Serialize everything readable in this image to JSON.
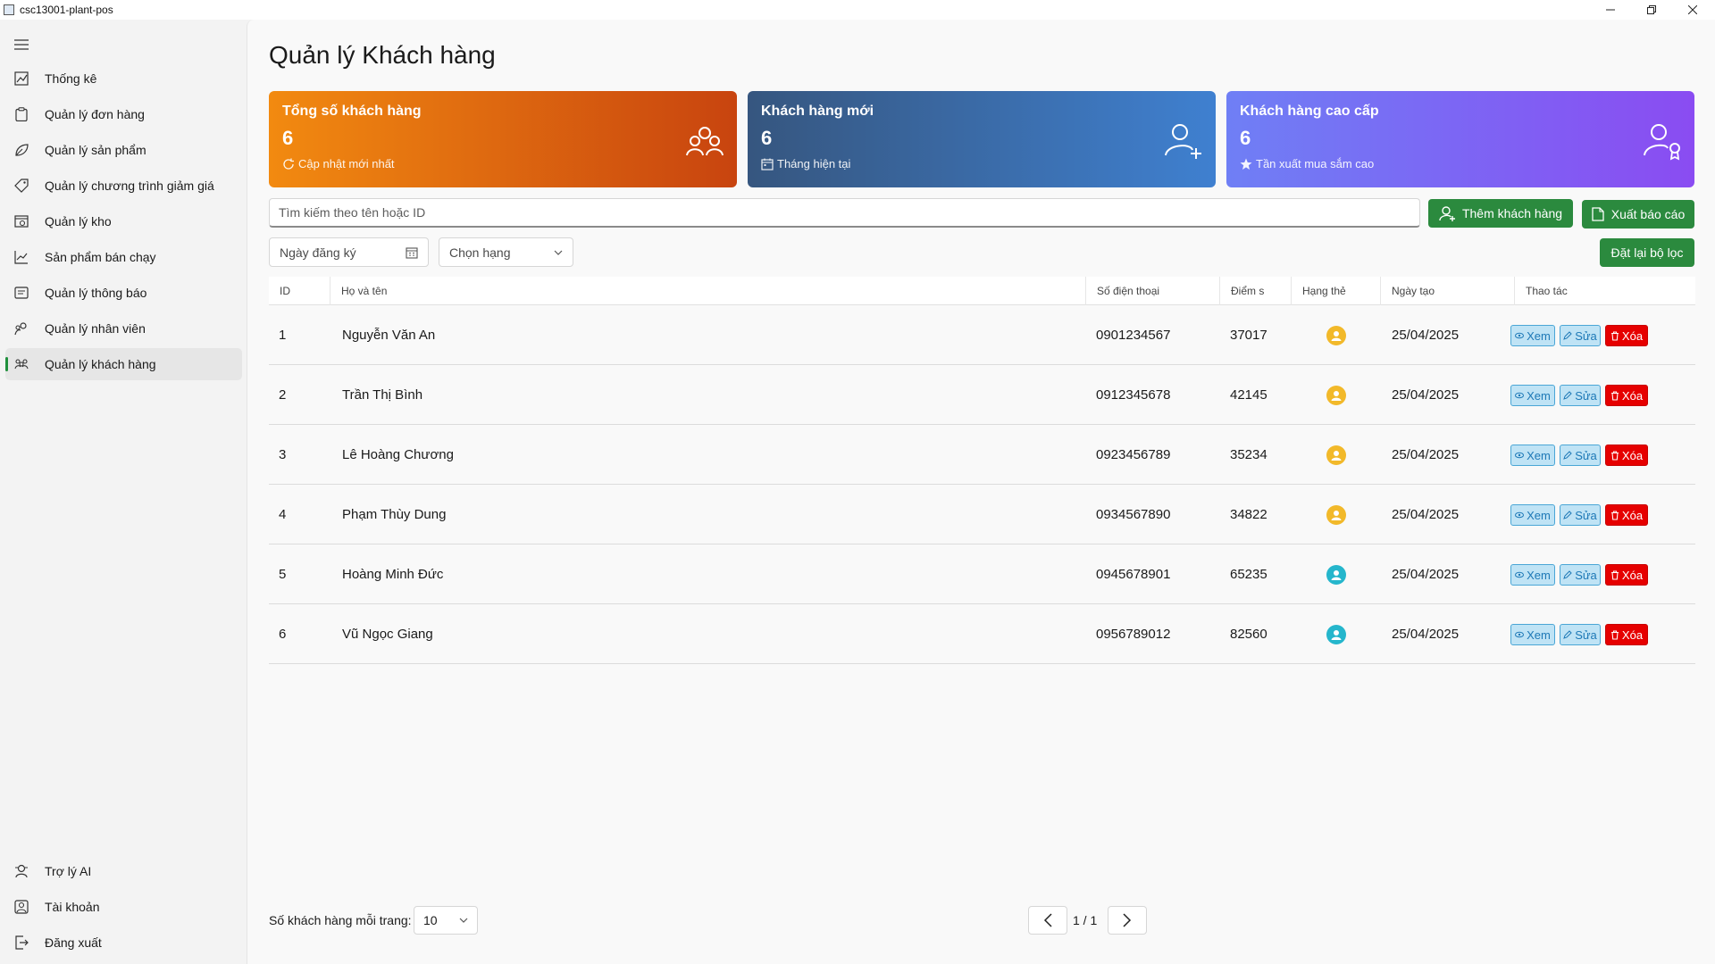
{
  "window": {
    "title": "csc13001-plant-pos"
  },
  "sidebar": {
    "items": [
      {
        "label": "Thống kê",
        "icon": "chart-icon"
      },
      {
        "label": "Quản lý đơn hàng",
        "icon": "clipboard-icon"
      },
      {
        "label": "Quản lý sản phẩm",
        "icon": "leaf-icon"
      },
      {
        "label": "Quản lý chương trình giảm giá",
        "icon": "tag-icon"
      },
      {
        "label": "Quản lý kho",
        "icon": "warehouse-icon"
      },
      {
        "label": "Sản phẩm bán chạy",
        "icon": "trend-icon"
      },
      {
        "label": "Quản lý thông báo",
        "icon": "message-icon"
      },
      {
        "label": "Quản lý nhân viên",
        "icon": "people-icon"
      },
      {
        "label": "Quản lý khách hàng",
        "icon": "customers-icon",
        "active": true
      }
    ],
    "bottom_items": [
      {
        "label": "Trợ lý AI",
        "icon": "bot-icon"
      },
      {
        "label": "Tài khoản",
        "icon": "account-icon"
      },
      {
        "label": "Đăng xuất",
        "icon": "logout-icon"
      }
    ]
  },
  "page": {
    "title": "Quản lý Khách hàng"
  },
  "cards": [
    {
      "title": "Tổng số khách hàng",
      "value": "6",
      "subtitle": "Cập nhật mới nhất",
      "sub_icon": "refresh-icon",
      "icon": "people-group-icon",
      "gradient": [
        "#f28a10",
        "#c8440f"
      ]
    },
    {
      "title": "Khách hàng mới",
      "value": "6",
      "subtitle": "Tháng hiện tại",
      "sub_icon": "calendar-icon",
      "icon": "person-add-icon",
      "gradient": [
        "#36567f",
        "#3f80d0"
      ]
    },
    {
      "title": "Khách hàng cao cấp",
      "value": "6",
      "subtitle": "Tần xuất mua sắm cao",
      "sub_icon": "star-icon",
      "icon": "person-award-icon",
      "gradient": [
        "#6f7ff5",
        "#8a4cf2"
      ]
    }
  ],
  "search": {
    "placeholder": "Tìm kiếm theo tên hoặc ID"
  },
  "buttons": {
    "add_customer": "Thêm khách hàng",
    "export_report": "Xuất báo cáo",
    "reset_filter": "Đặt lại bộ lọc"
  },
  "filters": {
    "date_placeholder": "Ngày đăng ký",
    "rank_placeholder": "Chọn hạng"
  },
  "table": {
    "headers": [
      "ID",
      "Họ và tên",
      "Số điện thoại",
      "Điểm s",
      "Hạng thẻ",
      "Ngày tạo",
      "Thao tác"
    ],
    "rows": [
      {
        "id": "1",
        "name": "Nguyễn Văn An",
        "phone": "0901234567",
        "points": "37017",
        "rank_color": "#f2b92a",
        "created": "25/04/2025"
      },
      {
        "id": "2",
        "name": "Trần Thị Bình",
        "phone": "0912345678",
        "points": "42145",
        "rank_color": "#f2b92a",
        "created": "25/04/2025"
      },
      {
        "id": "3",
        "name": "Lê Hoàng Chương",
        "phone": "0923456789",
        "points": "35234",
        "rank_color": "#f2b92a",
        "created": "25/04/2025"
      },
      {
        "id": "4",
        "name": "Phạm Thùy Dung",
        "phone": "0934567890",
        "points": "34822",
        "rank_color": "#f2b92a",
        "created": "25/04/2025"
      },
      {
        "id": "5",
        "name": "Hoàng Minh Đức",
        "phone": "0945678901",
        "points": "65235",
        "rank_color": "#25b6cc",
        "created": "25/04/2025"
      },
      {
        "id": "6",
        "name": "Vũ Ngọc Giang",
        "phone": "0956789012",
        "points": "82560",
        "rank_color": "#25b6cc",
        "created": "25/04/2025"
      }
    ],
    "actions": {
      "view": "Xem",
      "edit": "Sửa",
      "delete": "Xóa"
    }
  },
  "pagination": {
    "per_page_label": "Số khách hàng mỗi trang:",
    "per_page": "10",
    "page_text": "1 / 1"
  },
  "colors": {
    "accent_green": "#2b8a3e",
    "delete_red": "#e60000",
    "view_blue": "#1d78b6"
  }
}
